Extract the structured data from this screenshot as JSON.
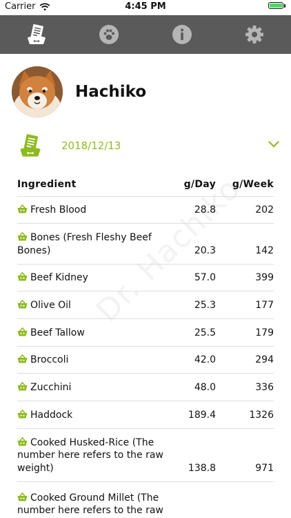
{
  "status_bar": {
    "carrier": "Carrier",
    "time": "4:45 PM"
  },
  "toolbar": {
    "tabs": [
      {
        "icon": "dog-bowl-menu-icon"
      },
      {
        "icon": "paw-icon"
      },
      {
        "icon": "info-icon"
      },
      {
        "icon": "gear-icon"
      }
    ]
  },
  "pet": {
    "name": "Hachiko"
  },
  "date_selector": {
    "date": "2018/12/13",
    "icon": "dog-bowl-menu-icon"
  },
  "watermark": "Dr. Hachiko",
  "table": {
    "headers": {
      "ingredient": "Ingredient",
      "per_day": "g/Day",
      "per_week": "g/Week"
    },
    "rows": [
      {
        "name": "Fresh Blood",
        "day": "28.8",
        "week": "202"
      },
      {
        "name": "Bones (Fresh Fleshy Beef Bones)",
        "day": "20.3",
        "week": "142"
      },
      {
        "name": "Beef Kidney",
        "day": "57.0",
        "week": "399"
      },
      {
        "name": "Olive Oil",
        "day": "25.3",
        "week": "177"
      },
      {
        "name": "Beef Tallow",
        "day": "25.5",
        "week": "179"
      },
      {
        "name": "Broccoli",
        "day": "42.0",
        "week": "294"
      },
      {
        "name": "Zucchini",
        "day": "48.0",
        "week": "336"
      },
      {
        "name": "Haddock",
        "day": "189.4",
        "week": "1326"
      },
      {
        "name": "Cooked Husked-Rice (The number here refers to the raw weight)",
        "day": "138.8",
        "week": "971"
      },
      {
        "name": "Cooked Ground Millet (The number here refers to the raw weight)",
        "day": "",
        "week": ""
      }
    ]
  },
  "colors": {
    "accent": "#8dbb1e",
    "toolbar": "#5a5a5a",
    "divider": "#dddddd"
  }
}
